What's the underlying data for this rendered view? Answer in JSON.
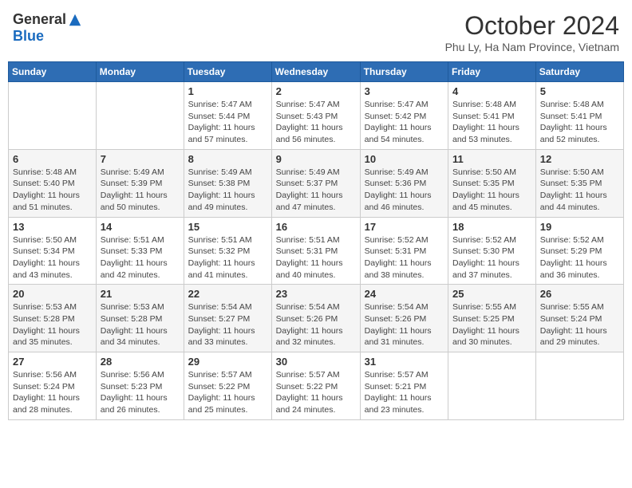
{
  "logo": {
    "general": "General",
    "blue": "Blue"
  },
  "header": {
    "month": "October 2024",
    "location": "Phu Ly, Ha Nam Province, Vietnam"
  },
  "weekdays": [
    "Sunday",
    "Monday",
    "Tuesday",
    "Wednesday",
    "Thursday",
    "Friday",
    "Saturday"
  ],
  "weeks": [
    [
      {
        "day": "",
        "detail": ""
      },
      {
        "day": "",
        "detail": ""
      },
      {
        "day": "1",
        "detail": "Sunrise: 5:47 AM\nSunset: 5:44 PM\nDaylight: 11 hours and 57 minutes."
      },
      {
        "day": "2",
        "detail": "Sunrise: 5:47 AM\nSunset: 5:43 PM\nDaylight: 11 hours and 56 minutes."
      },
      {
        "day": "3",
        "detail": "Sunrise: 5:47 AM\nSunset: 5:42 PM\nDaylight: 11 hours and 54 minutes."
      },
      {
        "day": "4",
        "detail": "Sunrise: 5:48 AM\nSunset: 5:41 PM\nDaylight: 11 hours and 53 minutes."
      },
      {
        "day": "5",
        "detail": "Sunrise: 5:48 AM\nSunset: 5:41 PM\nDaylight: 11 hours and 52 minutes."
      }
    ],
    [
      {
        "day": "6",
        "detail": "Sunrise: 5:48 AM\nSunset: 5:40 PM\nDaylight: 11 hours and 51 minutes."
      },
      {
        "day": "7",
        "detail": "Sunrise: 5:49 AM\nSunset: 5:39 PM\nDaylight: 11 hours and 50 minutes."
      },
      {
        "day": "8",
        "detail": "Sunrise: 5:49 AM\nSunset: 5:38 PM\nDaylight: 11 hours and 49 minutes."
      },
      {
        "day": "9",
        "detail": "Sunrise: 5:49 AM\nSunset: 5:37 PM\nDaylight: 11 hours and 47 minutes."
      },
      {
        "day": "10",
        "detail": "Sunrise: 5:49 AM\nSunset: 5:36 PM\nDaylight: 11 hours and 46 minutes."
      },
      {
        "day": "11",
        "detail": "Sunrise: 5:50 AM\nSunset: 5:35 PM\nDaylight: 11 hours and 45 minutes."
      },
      {
        "day": "12",
        "detail": "Sunrise: 5:50 AM\nSunset: 5:35 PM\nDaylight: 11 hours and 44 minutes."
      }
    ],
    [
      {
        "day": "13",
        "detail": "Sunrise: 5:50 AM\nSunset: 5:34 PM\nDaylight: 11 hours and 43 minutes."
      },
      {
        "day": "14",
        "detail": "Sunrise: 5:51 AM\nSunset: 5:33 PM\nDaylight: 11 hours and 42 minutes."
      },
      {
        "day": "15",
        "detail": "Sunrise: 5:51 AM\nSunset: 5:32 PM\nDaylight: 11 hours and 41 minutes."
      },
      {
        "day": "16",
        "detail": "Sunrise: 5:51 AM\nSunset: 5:31 PM\nDaylight: 11 hours and 40 minutes."
      },
      {
        "day": "17",
        "detail": "Sunrise: 5:52 AM\nSunset: 5:31 PM\nDaylight: 11 hours and 38 minutes."
      },
      {
        "day": "18",
        "detail": "Sunrise: 5:52 AM\nSunset: 5:30 PM\nDaylight: 11 hours and 37 minutes."
      },
      {
        "day": "19",
        "detail": "Sunrise: 5:52 AM\nSunset: 5:29 PM\nDaylight: 11 hours and 36 minutes."
      }
    ],
    [
      {
        "day": "20",
        "detail": "Sunrise: 5:53 AM\nSunset: 5:28 PM\nDaylight: 11 hours and 35 minutes."
      },
      {
        "day": "21",
        "detail": "Sunrise: 5:53 AM\nSunset: 5:28 PM\nDaylight: 11 hours and 34 minutes."
      },
      {
        "day": "22",
        "detail": "Sunrise: 5:54 AM\nSunset: 5:27 PM\nDaylight: 11 hours and 33 minutes."
      },
      {
        "day": "23",
        "detail": "Sunrise: 5:54 AM\nSunset: 5:26 PM\nDaylight: 11 hours and 32 minutes."
      },
      {
        "day": "24",
        "detail": "Sunrise: 5:54 AM\nSunset: 5:26 PM\nDaylight: 11 hours and 31 minutes."
      },
      {
        "day": "25",
        "detail": "Sunrise: 5:55 AM\nSunset: 5:25 PM\nDaylight: 11 hours and 30 minutes."
      },
      {
        "day": "26",
        "detail": "Sunrise: 5:55 AM\nSunset: 5:24 PM\nDaylight: 11 hours and 29 minutes."
      }
    ],
    [
      {
        "day": "27",
        "detail": "Sunrise: 5:56 AM\nSunset: 5:24 PM\nDaylight: 11 hours and 28 minutes."
      },
      {
        "day": "28",
        "detail": "Sunrise: 5:56 AM\nSunset: 5:23 PM\nDaylight: 11 hours and 26 minutes."
      },
      {
        "day": "29",
        "detail": "Sunrise: 5:57 AM\nSunset: 5:22 PM\nDaylight: 11 hours and 25 minutes."
      },
      {
        "day": "30",
        "detail": "Sunrise: 5:57 AM\nSunset: 5:22 PM\nDaylight: 11 hours and 24 minutes."
      },
      {
        "day": "31",
        "detail": "Sunrise: 5:57 AM\nSunset: 5:21 PM\nDaylight: 11 hours and 23 minutes."
      },
      {
        "day": "",
        "detail": ""
      },
      {
        "day": "",
        "detail": ""
      }
    ]
  ]
}
